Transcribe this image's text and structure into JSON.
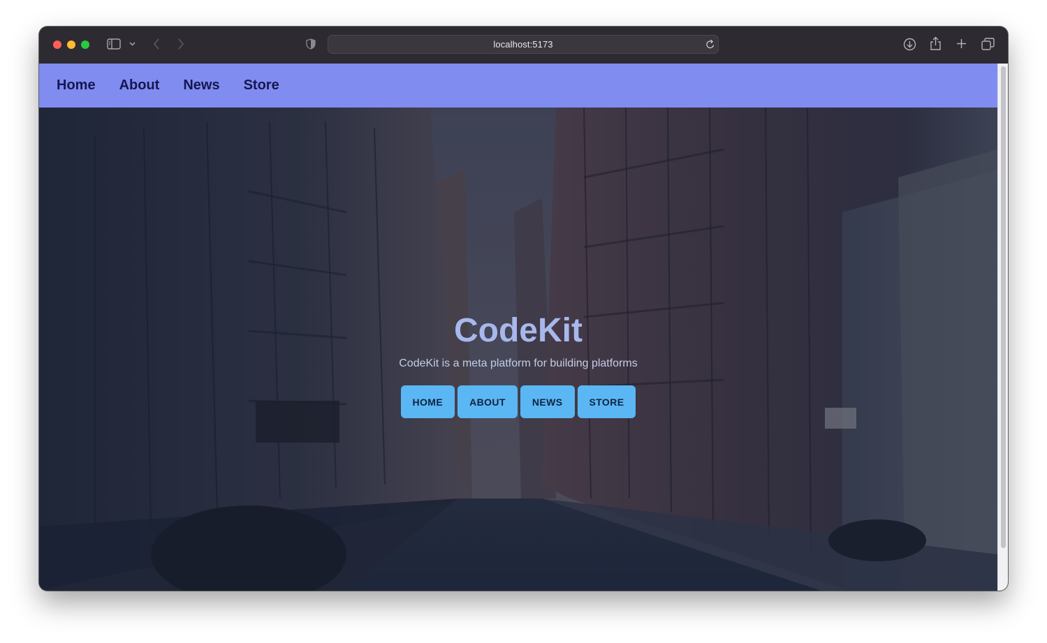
{
  "browser": {
    "url": "localhost:5173",
    "icons": [
      "sidebar-icon",
      "chevron-down-icon",
      "back-arrow-icon",
      "forward-arrow-icon",
      "shield-icon",
      "reload-icon",
      "download-icon",
      "share-icon",
      "plus-icon",
      "tabs-overview-icon"
    ]
  },
  "nav": {
    "background": "#818cf0",
    "links": [
      "Home",
      "About",
      "News",
      "Store"
    ]
  },
  "hero": {
    "title": "CodeKit",
    "subtitle": "CodeKit is a meta platform for building platforms",
    "buttons": [
      "HOME",
      "ABOUT",
      "NEWS",
      "STORE"
    ],
    "button_color": "#5bb6f4",
    "title_color": "#a8b8ec"
  }
}
